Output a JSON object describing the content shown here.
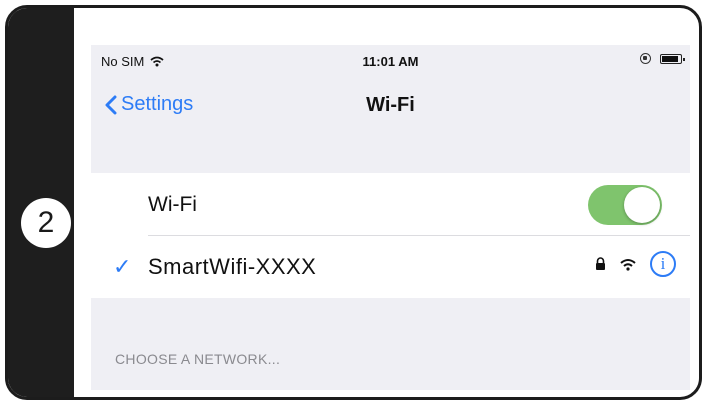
{
  "step": {
    "number": "2"
  },
  "status_bar": {
    "carrier": "No SIM",
    "time": "11:01 AM",
    "icons": [
      "wifi-signal-icon",
      "rotation-lock-icon",
      "battery-icon"
    ]
  },
  "nav": {
    "back_label": "Settings",
    "title": "Wi-Fi"
  },
  "wifi": {
    "label": "Wi-Fi",
    "enabled": true,
    "toggle_color": "#7fc46d"
  },
  "connected_network": {
    "name": "SmartWifi-XXXX",
    "secured": true,
    "icons": [
      "checkmark-icon",
      "lock-icon",
      "wifi-signal-icon",
      "info-icon"
    ]
  },
  "sections": {
    "choose_network_header": "CHOOSE A NETWORK..."
  },
  "colors": {
    "accent": "#2d7cf6",
    "background": "#efeff4",
    "frame": "#1e1e1e"
  }
}
